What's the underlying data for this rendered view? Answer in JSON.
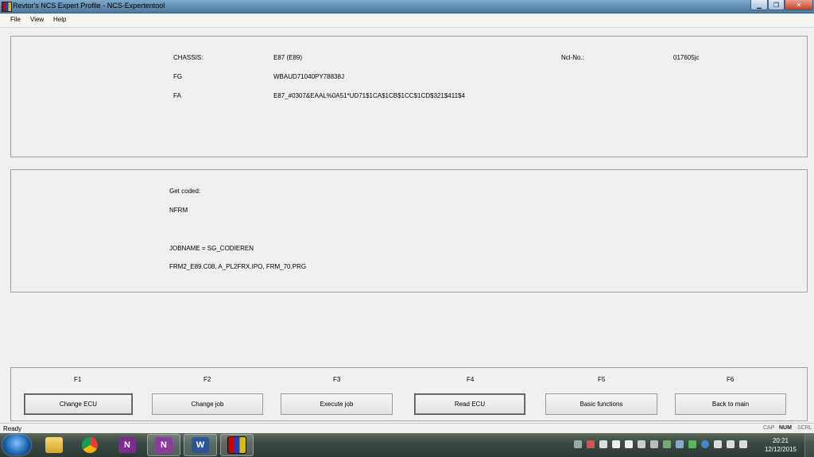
{
  "window": {
    "title": "Revtor's NCS Expert Profile - NCS-Expertentool"
  },
  "menu": {
    "items": [
      "File",
      "View",
      "Help"
    ]
  },
  "vehicle": {
    "chassis_label": "CHASSIS:",
    "chassis_value": "E87 (E89)",
    "ncl_label": "Ncl-No.:",
    "ncl_value": "017605jc",
    "fg_label": "FG",
    "fg_value": "WBAUD71040PY78838J",
    "fa_label": "FA",
    "fa_value": "E87_#0307&EAAL%0A51*UD71$1CA$1CB$1CC$1CD$321$411$4"
  },
  "job": {
    "get_coded_label": "Get coded:",
    "ecu": "NFRM",
    "jobname": "JOBNAME = SG_CODIEREN",
    "files": "FRM2_E89.C08, A_PL2FRX.IPO, FRM_70.PRG"
  },
  "functions": [
    {
      "key": "F1",
      "label": "Change ECU"
    },
    {
      "key": "F2",
      "label": "Change job"
    },
    {
      "key": "F3",
      "label": "Execute job"
    },
    {
      "key": "F4",
      "label": "Read ECU"
    },
    {
      "key": "F5",
      "label": "Basic functions"
    },
    {
      "key": "F6",
      "label": "Back to main"
    }
  ],
  "status": {
    "text": "Ready",
    "indicators": [
      "CAP",
      "NUM",
      "SCRL"
    ]
  },
  "taskbar": {
    "apps": [
      {
        "icon": "windows-explorer-icon",
        "glyph": ""
      },
      {
        "icon": "chrome-icon",
        "glyph": ""
      },
      {
        "icon": "onenote-icon",
        "glyph": "N"
      },
      {
        "icon": "onenote-clipper-icon",
        "glyph": "N"
      },
      {
        "icon": "word-icon",
        "glyph": "W"
      },
      {
        "icon": "ncs-expert-icon",
        "glyph": ""
      }
    ],
    "clock_time": "20:21",
    "clock_date": "12/12/2015"
  },
  "colors": {
    "titlebar": "#6a93b6",
    "close_button": "#c5422a",
    "panel_border": "#a0a0a0",
    "background": "#f0f0f0"
  }
}
